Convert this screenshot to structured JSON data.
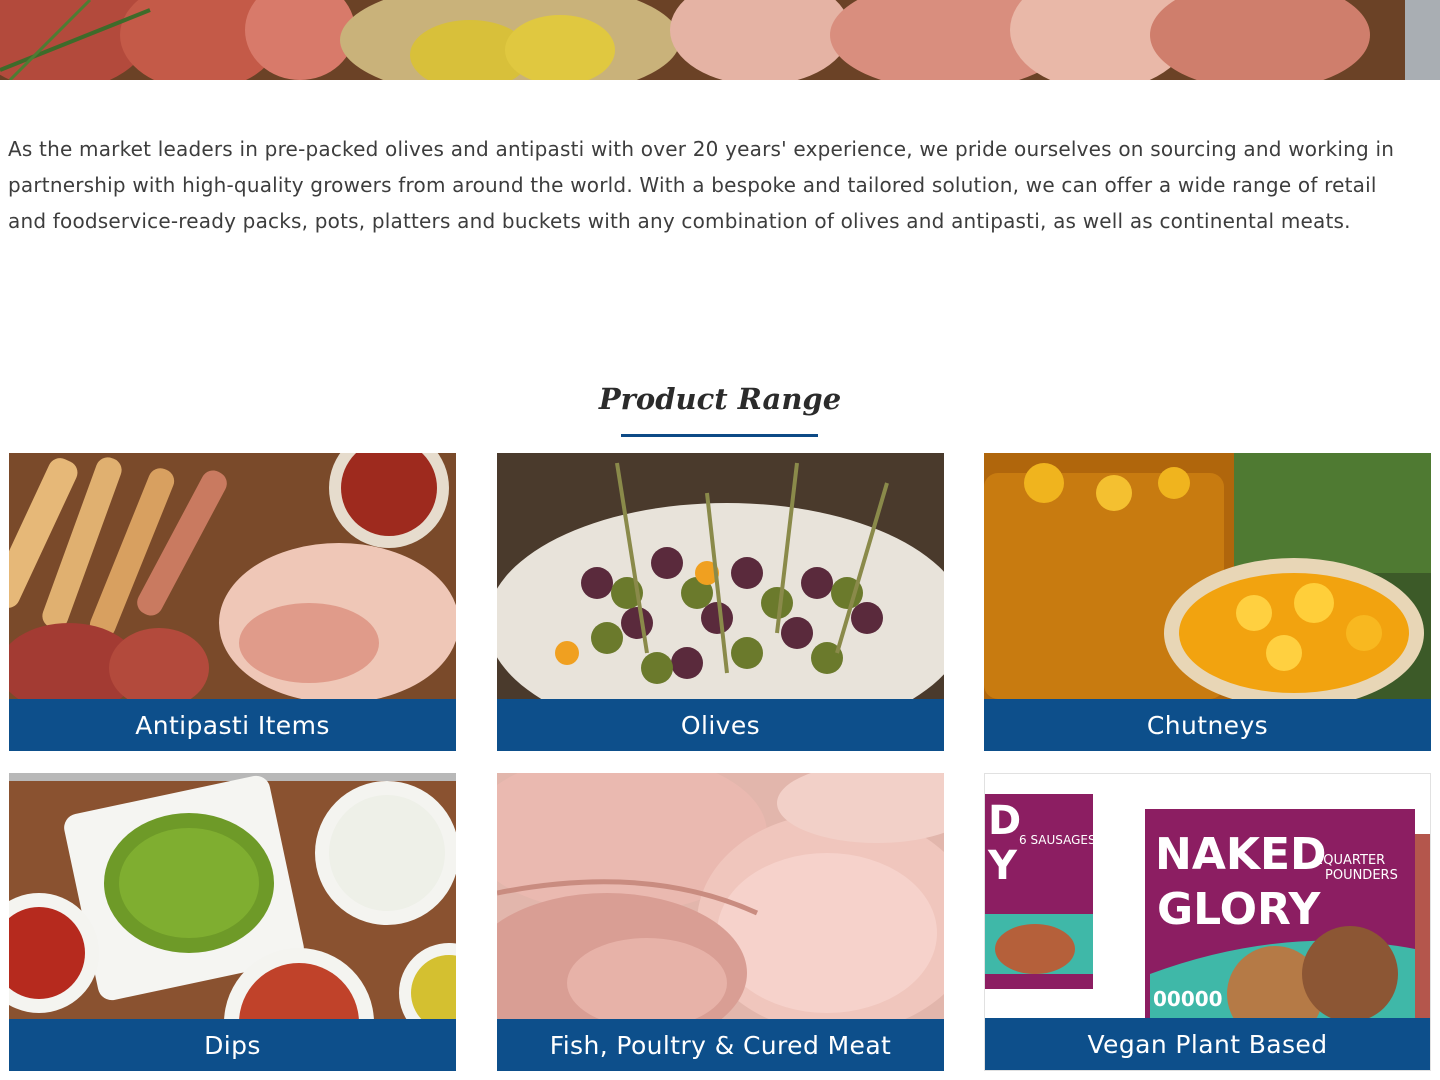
{
  "intro": {
    "paragraph": "As the market leaders in pre-packed olives and antipasti with over 20 years' experience, we pride ourselves on sourcing and working in partnership with high-quality growers from around the world. With a bespoke and tailored solution, we can offer a wide range of retail and foodservice-ready packs, pots, platters and buckets with any combination of olives and antipasti, as well as continental meats."
  },
  "product_range": {
    "title": "Product Range",
    "accent_color": "#0d4f8b",
    "items": [
      {
        "label": "Antipasti Items",
        "image_icon": "antipasti-photo"
      },
      {
        "label": "Olives",
        "image_icon": "olives-photo"
      },
      {
        "label": "Chutneys",
        "image_icon": "chutney-photo"
      },
      {
        "label": "Dips",
        "image_icon": "dips-photo"
      },
      {
        "label": "Fish, Poultry & Cured Meat",
        "image_icon": "cured-meat-photo"
      },
      {
        "label": "Vegan Plant Based",
        "image_icon": "vegan-pack-photo"
      }
    ]
  },
  "packaging": {
    "brand": "NAKED GLORY",
    "pack_left_text": "6 SAUSAGES",
    "pack_right_text": "2 QUARTER POUNDERS"
  }
}
